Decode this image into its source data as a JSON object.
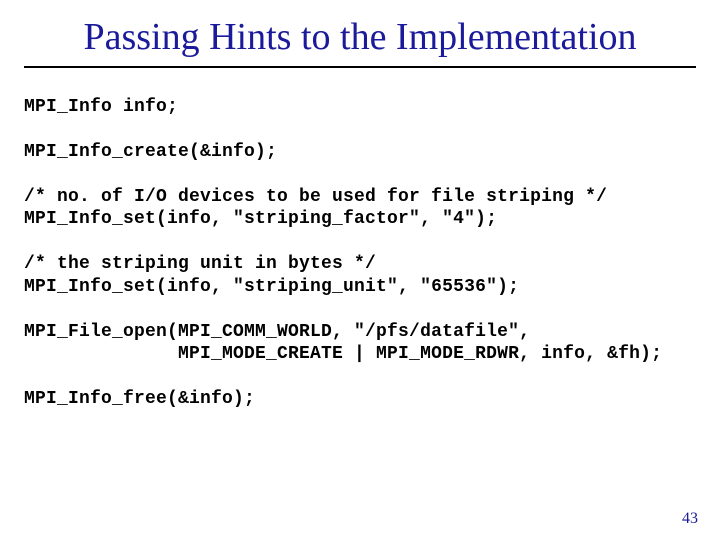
{
  "slide": {
    "title": "Passing Hints to the Implementation",
    "page_number": "43",
    "code_lines": [
      "MPI_Info info;",
      "",
      "MPI_Info_create(&info);",
      "",
      "/* no. of I/O devices to be used for file striping */",
      "MPI_Info_set(info, \"striping_factor\", \"4\");",
      "",
      "/* the striping unit in bytes */",
      "MPI_Info_set(info, \"striping_unit\", \"65536\");",
      "",
      "MPI_File_open(MPI_COMM_WORLD, \"/pfs/datafile\", ",
      "              MPI_MODE_CREATE | MPI_MODE_RDWR, info, &fh);",
      "",
      "MPI_Info_free(&info);"
    ]
  }
}
